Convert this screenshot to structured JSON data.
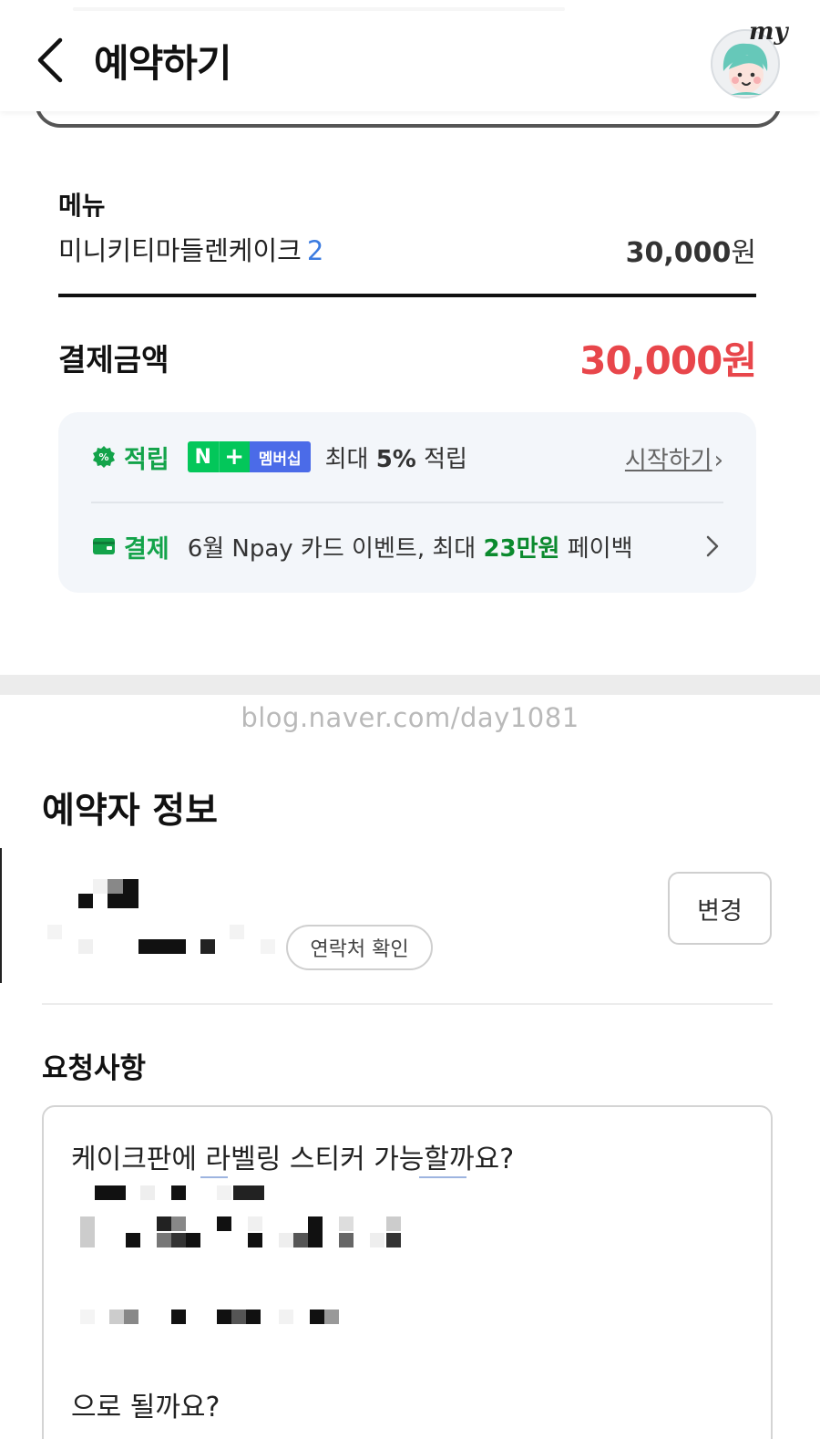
{
  "header": {
    "title": "예약하기",
    "back_icon": "chevron-left-icon",
    "avatar_label": "my"
  },
  "menu": {
    "label": "메뉴",
    "item_name": "미니키티마들렌케이크",
    "item_qty": "2",
    "item_price": "30,000",
    "price_unit": "원"
  },
  "total": {
    "label": "결제금액",
    "amount": "30,000원"
  },
  "benefits": {
    "reward": {
      "tag": "적립",
      "badge_n": "N",
      "badge_plus": "+",
      "badge_membership": "멤버십",
      "text_pre": "최대 ",
      "text_strong": "5%",
      "text_post": " 적립",
      "link": "시작하기",
      "link_chevron": "›"
    },
    "payment": {
      "tag": "결제",
      "text_pre": "6월 Npay 카드 이벤트, 최대 ",
      "text_strong": "23만원",
      "text_post": " 페이백"
    }
  },
  "watermark": "blog.naver.com/day1081",
  "booker": {
    "title": "예약자 정보",
    "change_button": "변경",
    "contact_button": "연락처 확인"
  },
  "request": {
    "title": "요청사항",
    "line1": "케이크판에 라벨링 스티커 가능할까요?",
    "line_end": "으로 될까요?"
  },
  "colors": {
    "price_red": "#e8464b",
    "naver_green": "#03c75a",
    "membership_blue": "#4b6be8",
    "qty_blue": "#3b7be0"
  }
}
